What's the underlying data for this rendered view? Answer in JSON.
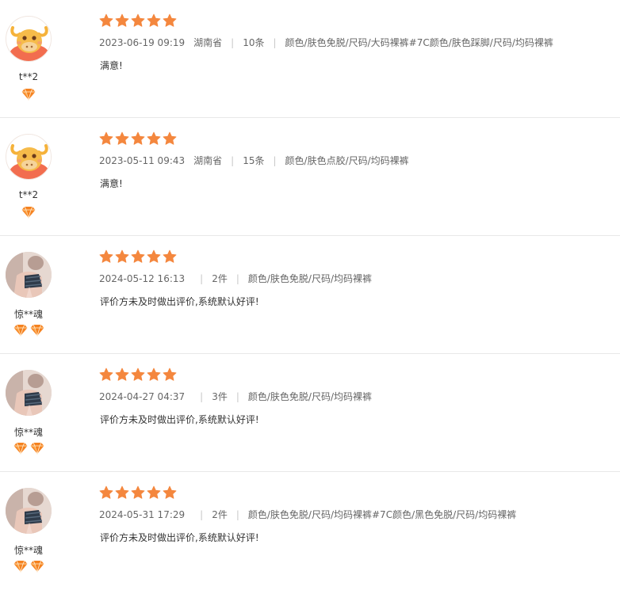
{
  "reviews": [
    {
      "user": "t**2",
      "avatar": "ox-avatar",
      "badge_count": 1,
      "rating": 5,
      "date": "2023-06-19 09:19",
      "location": "湖南省",
      "quantity": "10条",
      "sku": "颜色/肤色免脱/尺码/大码裸裤#7C颜色/肤色踩脚/尺码/均码裸裤",
      "comment": "满意!"
    },
    {
      "user": "t**2",
      "avatar": "ox-avatar",
      "badge_count": 1,
      "rating": 5,
      "date": "2023-05-11 09:43",
      "location": "湖南省",
      "quantity": "15条",
      "sku": "颜色/肤色点胶/尺码/均码裸裤",
      "comment": "满意!"
    },
    {
      "user": "惊**魂",
      "avatar": "photo-avatar",
      "badge_count": 2,
      "rating": 5,
      "date": "2024-05-12 16:13",
      "location": "",
      "quantity": "2件",
      "sku": "颜色/肤色免脱/尺码/均码裸裤",
      "comment": "评价方未及时做出评价,系统默认好评!"
    },
    {
      "user": "惊**魂",
      "avatar": "photo-avatar",
      "badge_count": 2,
      "rating": 5,
      "date": "2024-04-27 04:37",
      "location": "",
      "quantity": "3件",
      "sku": "颜色/肤色免脱/尺码/均码裸裤",
      "comment": "评价方未及时做出评价,系统默认好评!"
    },
    {
      "user": "惊**魂",
      "avatar": "photo-avatar",
      "badge_count": 2,
      "rating": 5,
      "date": "2024-05-31 17:29",
      "location": "",
      "quantity": "2件",
      "sku": "颜色/肤色免脱/尺码/均码裸裤#7C颜色/黑色免脱/尺码/均码裸裤",
      "comment": "评价方未及时做出评价,系统默认好评!"
    }
  ],
  "colors": {
    "star": "#f4873e",
    "badge": "#f58220",
    "text": "#333333",
    "meta": "#666666",
    "separator": "#c8c8c8"
  },
  "icons": {
    "star": "star-icon",
    "badge": "diamond-badge-icon"
  }
}
